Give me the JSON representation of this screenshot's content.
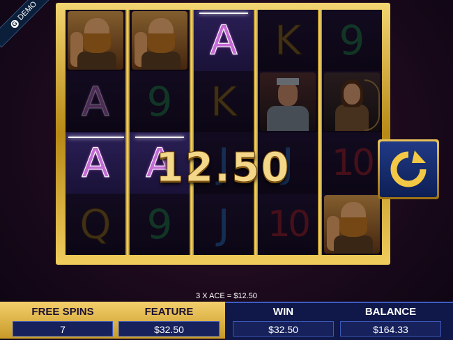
{
  "demo_label": "DEMO",
  "win_amount": "12.50",
  "win_line_text": "3 X ACE = $12.50",
  "reels": [
    [
      "viking",
      "A",
      "A",
      "Q"
    ],
    [
      "viking",
      "9",
      "A",
      "9"
    ],
    [
      "A",
      "K",
      "J",
      "J"
    ],
    [
      "K",
      "knight",
      "J",
      "10"
    ],
    [
      "9",
      "archer",
      "10",
      "viking"
    ]
  ],
  "winning_positions": [
    [
      0,
      2
    ],
    [
      1,
      2
    ],
    [
      2,
      0
    ]
  ],
  "footer": {
    "free_spins_label": "FREE SPINS",
    "free_spins_value": "7",
    "feature_label": "FEATURE",
    "feature_value": "$32.50",
    "win_label": "WIN",
    "win_value": "$32.50",
    "balance_label": "BALANCE",
    "balance_value": "$164.33"
  },
  "colors": {
    "gold": "#d4a52a",
    "panel_blue": "#0f1848",
    "ace_purple": "#c56bd6"
  },
  "spin_button_icon": "refresh-icon"
}
